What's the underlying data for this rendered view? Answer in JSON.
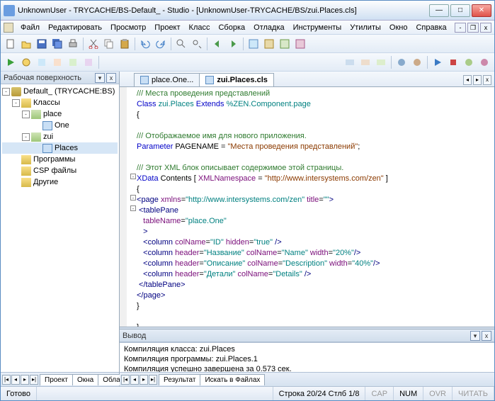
{
  "title": "UnknownUser - TRYCACHE/BS-Default_ - Studio - [UnknownUser-TRYCACHE/BS/zui.Places.cls]",
  "menu": [
    "Файл",
    "Редактировать",
    "Просмотр",
    "Проект",
    "Класс",
    "Сборка",
    "Отладка",
    "Инструменты",
    "Утилиты",
    "Окно",
    "Справка"
  ],
  "workspace": {
    "title": "Рабочая поверхность",
    "root": "Default_ (TRYCACHE:BS)",
    "nodes": {
      "classes": "Классы",
      "place": "place",
      "place_one": "One",
      "zui": "zui",
      "zui_places": "Places",
      "programs": "Программы",
      "csp": "CSP файлы",
      "other": "Другие"
    },
    "tabs": [
      "Проект",
      "Окна",
      "Область"
    ]
  },
  "editor_tabs": {
    "t1": "place.One...",
    "t2": "zui.Places.cls"
  },
  "code": {
    "l1": "/// Места проведения представлений",
    "l2a": "Class ",
    "l2b": "zui.Places ",
    "l2c": "Extends ",
    "l2d": "%ZEN.Component.page",
    "l3": "{",
    "l5": "/// Отображаемое имя для нового приложения.",
    "l6a": "Parameter ",
    "l6b": "PAGENAME = ",
    "l6c": "\"Места проведения представлений\"",
    "l6d": ";",
    "l8": "/// Этот XML блок описывает содержимое этой страницы.",
    "l9a": "XData ",
    "l9b": "Contents ",
    "l9c": "[ ",
    "l9d": "XMLNamespace",
    "l9e": " = ",
    "l9f": "\"http://www.intersystems.com/zen\"",
    "l9g": " ]",
    "l10": "{",
    "l11a": "<",
    "l11b": "page ",
    "l11c": "xmlns",
    "l11d": "=",
    "l11e": "\"http://www.intersystems.com/zen\"",
    "l11f": " title",
    "l11g": "=",
    "l11h": "\"\"",
    "l11i": ">",
    "l12a": " <",
    "l12b": "tablePane",
    "l13a": "   tableName",
    "l13b": "=",
    "l13c": "\"place.One\"",
    "l14a": "   >",
    "l15a": "   <",
    "l15b": "column ",
    "l15c": "colName",
    "l15d": "=",
    "l15e": "\"ID\"",
    "l15f": " hidden",
    "l15g": "=",
    "l15h": "\"true\"",
    "l15i": " />",
    "l16a": "   <",
    "l16b": "column ",
    "l16c": "header",
    "l16d": "=",
    "l16e": "\"Название\"",
    "l16f": " colName",
    "l16g": "=",
    "l16h": "\"Name\"",
    "l16i": " width",
    "l16j": "=",
    "l16k": "\"20%\"",
    "l16l": "/>",
    "l17a": "   <",
    "l17b": "column ",
    "l17c": "header",
    "l17d": "=",
    "l17e": "\"Описание\"",
    "l17f": " colName",
    "l17g": "=",
    "l17h": "\"Description\"",
    "l17i": " width",
    "l17j": "=",
    "l17k": "\"40%\"",
    "l17l": "/>",
    "l18a": "   <",
    "l18b": "column ",
    "l18c": "header",
    "l18d": "=",
    "l18e": "\"Детали\"",
    "l18f": " colName",
    "l18g": "=",
    "l18h": "\"Details\"",
    "l18i": " />",
    "l19a": " </",
    "l19b": "tablePane",
    "l19c": ">",
    "l20a": "</",
    "l20b": "page",
    "l20c": ">",
    "l21": "}",
    "l23": "}"
  },
  "output": {
    "title": "Вывод",
    "l1": "Компиляция класса: zui.Places",
    "l2": "Компиляция программы: zui.Places.1",
    "l3": "Компиляция успешно завершена за 0.573 сек.",
    "tabs": [
      "Результат",
      "Искать в Файлах"
    ]
  },
  "status": {
    "ready": "Готово",
    "pos": "Строка 20/24 Стлб 1/8",
    "caps": "CAP",
    "num": "NUM",
    "ovr": "OVR",
    "read": "ЧИТАТЬ"
  }
}
